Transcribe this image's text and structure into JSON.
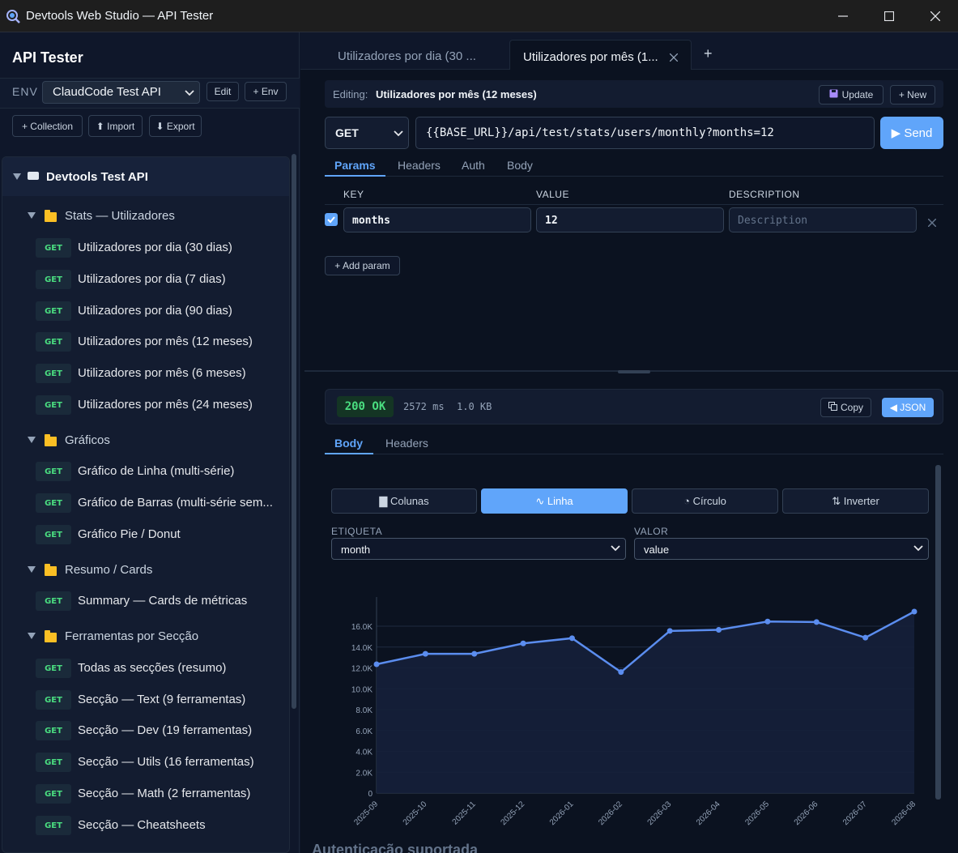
{
  "window": {
    "title": "Devtools Web Studio — API Tester",
    "controls": [
      "minimize-icon",
      "maximize-icon",
      "close-icon"
    ]
  },
  "sidebar": {
    "title": "API Tester",
    "env_label": "ENV",
    "env_selected": "ClaudCode Test API",
    "edit_label": "Edit",
    "add_env_label": "+ Env",
    "collection_label": "+ Collection",
    "import_label": "⬆ Import",
    "export_label": "⬇ Export",
    "root": "Devtools Test API",
    "groups": [
      {
        "name": "Stats — Utilizadores",
        "items": [
          {
            "method": "GET",
            "label": "Utilizadores por dia (30 dias)"
          },
          {
            "method": "GET",
            "label": "Utilizadores por dia (7 dias)"
          },
          {
            "method": "GET",
            "label": "Utilizadores por dia (90 dias)"
          },
          {
            "method": "GET",
            "label": "Utilizadores por mês (12 meses)"
          },
          {
            "method": "GET",
            "label": "Utilizadores por mês (6 meses)"
          },
          {
            "method": "GET",
            "label": "Utilizadores por mês (24 meses)"
          }
        ]
      },
      {
        "name": "Gráficos",
        "items": [
          {
            "method": "GET",
            "label": "Gráfico de Linha (multi-série)"
          },
          {
            "method": "GET",
            "label": "Gráfico de Barras (multi-série sem..."
          },
          {
            "method": "GET",
            "label": "Gráfico Pie / Donut"
          }
        ]
      },
      {
        "name": "Resumo / Cards",
        "items": [
          {
            "method": "GET",
            "label": "Summary — Cards de métricas"
          }
        ]
      },
      {
        "name": "Ferramentas por Secção",
        "items": [
          {
            "method": "GET",
            "label": "Todas as secções (resumo)"
          },
          {
            "method": "GET",
            "label": "Secção — Text (9 ferramentas)"
          },
          {
            "method": "GET",
            "label": "Secção — Dev (19 ferramentas)"
          },
          {
            "method": "GET",
            "label": "Secção — Utils (16 ferramentas)"
          },
          {
            "method": "GET",
            "label": "Secção — Math (2 ferramentas)"
          },
          {
            "method": "GET",
            "label": "Secção — Cheatsheets"
          }
        ]
      }
    ]
  },
  "tabs": {
    "items": [
      "Utilizadores por dia (30 ...",
      "Utilizadores por mês (1..."
    ],
    "active_index": 1,
    "add_label": "+"
  },
  "editing": {
    "label": "Editing:",
    "name": "Utilizadores por mês (12 meses)",
    "update_label": "Update",
    "new_label": "+ New"
  },
  "request": {
    "method": "GET",
    "url": "{{BASE_URL}}/api/test/stats/users/monthly?months=12",
    "send_label": "▶ Send",
    "subtabs": [
      "Params",
      "Headers",
      "Auth",
      "Body"
    ],
    "active_subtab": "Params"
  },
  "params": {
    "headers": [
      "KEY",
      "VALUE",
      "DESCRIPTION"
    ],
    "rows": [
      {
        "checked": true,
        "key": "months",
        "value": "12",
        "description": ""
      }
    ],
    "description_placeholder": "Description",
    "add_label": "+ Add param"
  },
  "response": {
    "status": "200 OK",
    "time": "2572 ms",
    "size": "1.0 KB",
    "copy_label": "Copy",
    "json_label": "◀ JSON",
    "subtabs": [
      "Body",
      "Headers"
    ],
    "active_subtab": "Body"
  },
  "viz": {
    "modes": [
      "▇ Colunas",
      "∿ Linha",
      "◔ Círculo",
      "⇅ Inverter"
    ],
    "active_mode": "∿ Linha",
    "label_field_title": "ETIQUETA",
    "label_field_value": "month",
    "value_field_title": "VALOR",
    "value_field_value": "value"
  },
  "chart_data": {
    "type": "area",
    "categories": [
      "2025-09",
      "2025-10",
      "2025-11",
      "2025-12",
      "2026-01",
      "2026-02",
      "2026-03",
      "2026-04",
      "2026-05",
      "2026-06",
      "2026-07",
      "2026-08"
    ],
    "values": [
      12350,
      13350,
      13350,
      14350,
      14850,
      11600,
      15550,
      15650,
      16450,
      16400,
      14900,
      17400
    ],
    "yticks": [
      "0",
      "2.0K",
      "4.0K",
      "6.0K",
      "8.0K",
      "10.0K",
      "12.0K",
      "14.0K",
      "16.0K"
    ],
    "ylim": [
      0,
      17400
    ],
    "color": "#5b8def",
    "grid": true
  },
  "footer_text": "Autenticação suportada"
}
